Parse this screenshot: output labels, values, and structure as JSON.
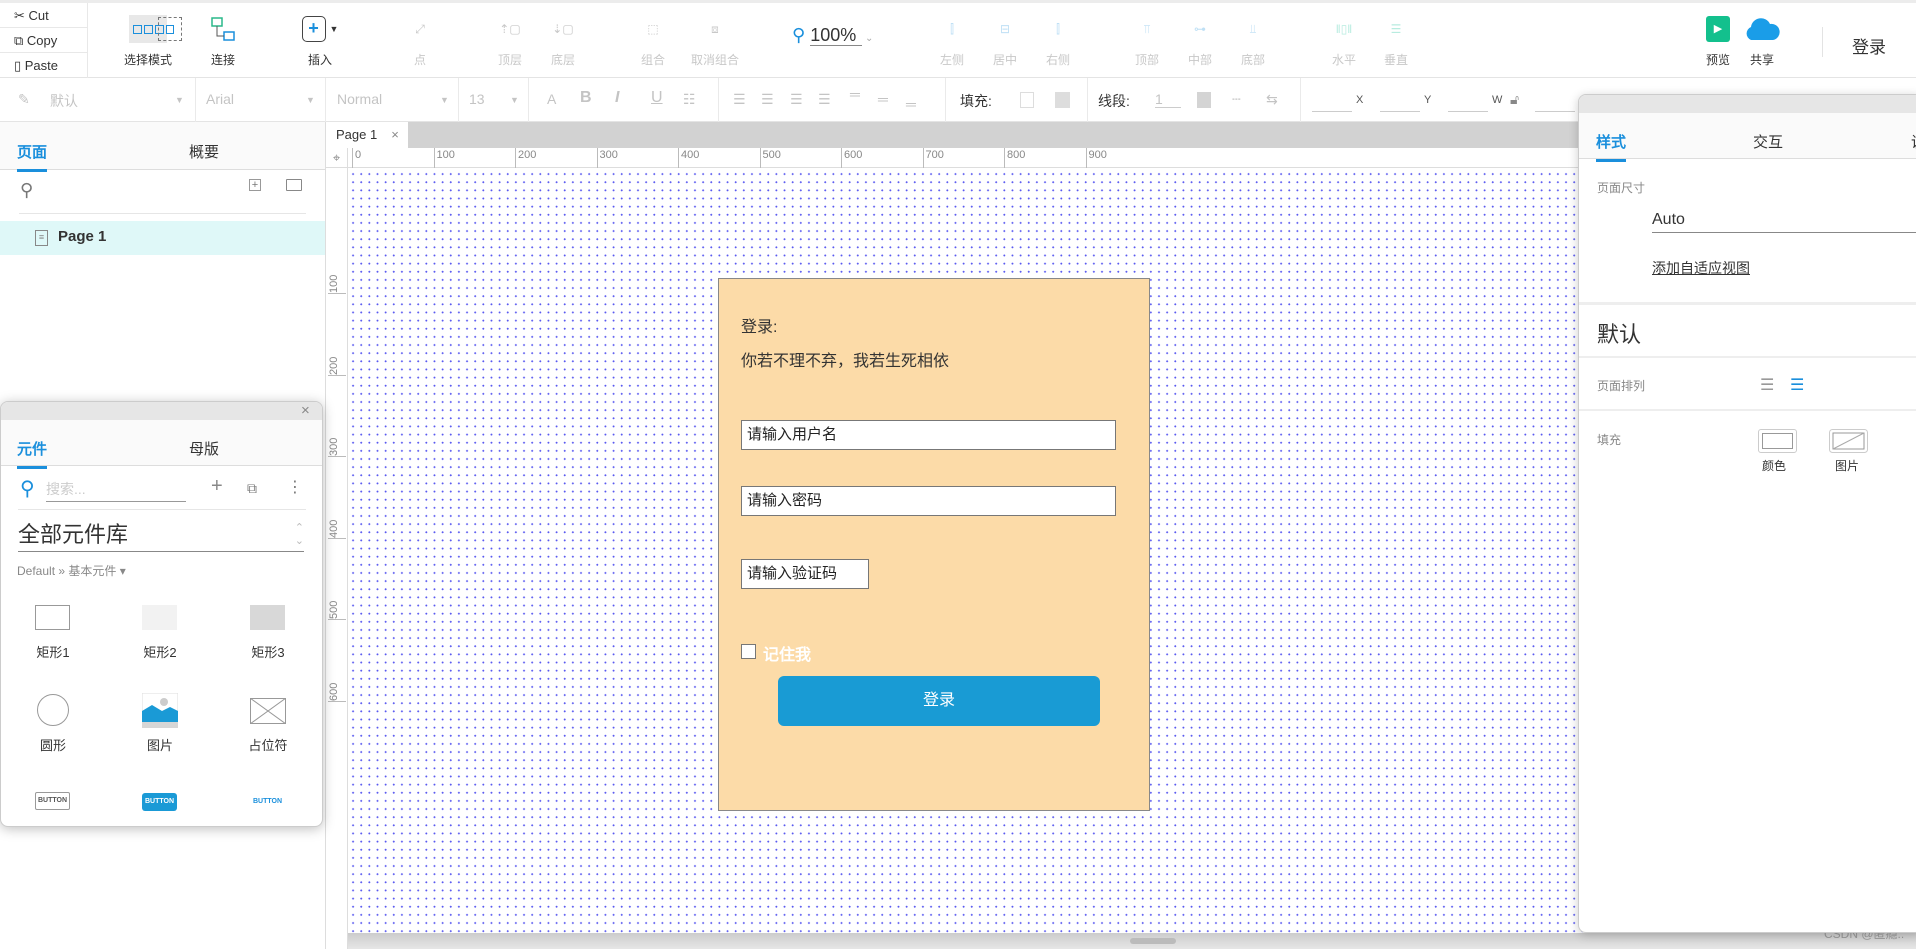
{
  "clipboard": {
    "cut": "Cut",
    "copy": "Copy",
    "paste": "Paste"
  },
  "toolbar": {
    "select_mode": "选择模式",
    "connect": "连接",
    "insert": "插入",
    "point": "点",
    "front": "顶层",
    "back": "底层",
    "group": "组合",
    "ungroup": "取消组合",
    "zoom": "100%",
    "left": "左侧",
    "center": "居中",
    "right": "右侧",
    "top": "顶部",
    "middle": "中部",
    "bottom": "底部",
    "horizontal": "水平",
    "vertical": "垂直",
    "preview": "预览",
    "share": "共享",
    "login": "登录"
  },
  "format_bar": {
    "style": "默认",
    "font": "Arial",
    "weight": "Normal",
    "size": "13",
    "fill_label": "填充:",
    "line_label": "线段:",
    "line_width": "1",
    "x": "X",
    "y": "Y",
    "w": "W"
  },
  "left_panel": {
    "tabs": [
      "页面",
      "概要"
    ],
    "pages": [
      "Page 1"
    ]
  },
  "widgets_panel": {
    "tabs": [
      "元件",
      "母版"
    ],
    "search_placeholder": "搜索...",
    "library": "全部元件库",
    "breadcrumb": "Default » 基本元件 ▾",
    "items": [
      "矩形1",
      "矩形2",
      "矩形3",
      "圆形",
      "图片",
      "占位符"
    ],
    "buttons": [
      "BUTTON",
      "BUTTON",
      "BUTTON"
    ]
  },
  "canvas": {
    "tab": "Page 1",
    "h_ruler": [
      "0",
      "100",
      "200",
      "300",
      "400",
      "500",
      "600",
      "700",
      "800",
      "900"
    ],
    "v_ruler": [
      "100",
      "200",
      "300",
      "400",
      "500",
      "600"
    ],
    "watermark": "CSDN @匿瘾:."
  },
  "form": {
    "title": "登录:",
    "subtitle": "你若不理不弃，我若生死相依",
    "username_placeholder": "请输入用户名",
    "password_placeholder": "请输入密码",
    "captcha_placeholder": "请输入验证码",
    "remember": "记住我",
    "submit": "登录",
    "bg_color": "#fcdba8",
    "button_color": "#199bd4"
  },
  "right_panel": {
    "tabs": [
      "样式",
      "交互",
      "说"
    ],
    "page_size_label": "页面尺寸",
    "page_size": "Auto",
    "adaptive_link": "添加自适应视图",
    "style_name": "默认",
    "align_label": "页面排列",
    "fill_label": "填充",
    "fill_color": "颜色",
    "fill_image": "图片"
  },
  "accent": "#1a8fdc"
}
